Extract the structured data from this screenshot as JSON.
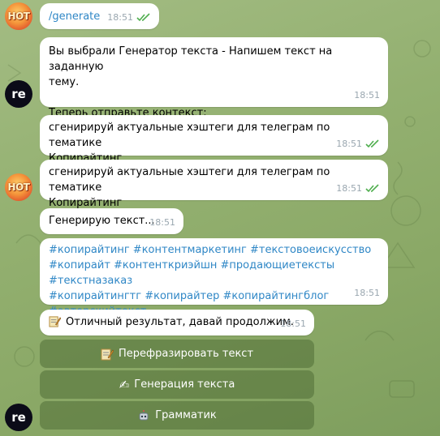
{
  "messages": {
    "m1": {
      "text": "/generate",
      "time": "18:51"
    },
    "m2": {
      "line1": "Вы выбрали Генератор текста - Напишем текст на заданную",
      "line2": "тему.",
      "line3": "Теперь отправьте контекст:",
      "time": "18:51"
    },
    "m3": {
      "line1": "сгенирируй актуальные хэштеги для телеграм  по тематике",
      "line2": "Копирайтинг",
      "time": "18:51"
    },
    "m4": {
      "line1": "сгенирируй актуальные хэштеги для телеграм  по тематике",
      "line2": "Копирайтинг",
      "time": "18:51"
    },
    "m5": {
      "text": "Генерирую текст...",
      "time": "18:51"
    },
    "m6": {
      "line1": "#копирайтинг #контентмаркетинг #текстовоеискусство",
      "line2": "#копирайт #контенткриэйшн #продающиетексты #текстназаказ",
      "line3": "#копирайтингтг #копирайтер #копирайтингблог",
      "line4": "#авторскийтекст",
      "time": "18:51"
    },
    "m7": {
      "text": "Отличный результат, давай продолжим.",
      "time": "18:51",
      "icon": "memo-icon"
    }
  },
  "avatars": {
    "hot": {
      "label": "HOT"
    },
    "re": {
      "label": "re"
    }
  },
  "buttons": [
    {
      "label": "Перефразировать текст",
      "icon": "memo-icon"
    },
    {
      "label": "Генерация текста",
      "icon": "writing-hand-icon"
    },
    {
      "label": "Грамматик",
      "icon": "robot-icon"
    }
  ],
  "colors": {
    "hashtag": "#2f87c6",
    "time": "#9aa7b0",
    "read_ticks": "#4fae4e",
    "bubble": "#ffffff"
  }
}
